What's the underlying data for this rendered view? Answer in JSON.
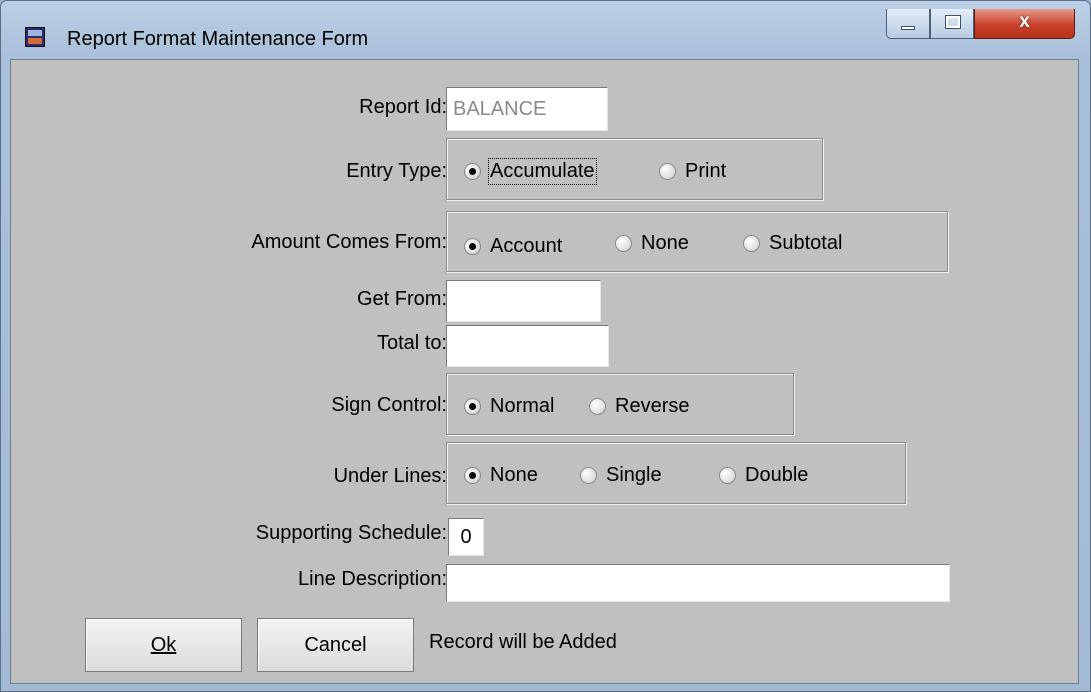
{
  "window": {
    "title": "Report Format Maintenance Form",
    "close_glyph": "x"
  },
  "form": {
    "report_id": {
      "label": "Report Id:",
      "value": "BALANCE"
    },
    "entry_type": {
      "label": "Entry Type:",
      "options": [
        "Accumulate",
        "Print"
      ],
      "selected": "Accumulate"
    },
    "amount_from": {
      "label": "Amount Comes From:",
      "options": [
        "Account",
        "None",
        "Subtotal"
      ],
      "selected": "Account"
    },
    "get_from": {
      "label": "Get From:",
      "value": ""
    },
    "total_to": {
      "label": "Total to:",
      "value": ""
    },
    "sign_control": {
      "label": "Sign Control:",
      "options": [
        "Normal",
        "Reverse"
      ],
      "selected": "Normal"
    },
    "under_lines": {
      "label": "Under Lines:",
      "options": [
        "None",
        "Single",
        "Double"
      ],
      "selected": "None"
    },
    "supporting_schedule": {
      "label": "Supporting Schedule:",
      "value": "0"
    },
    "line_description": {
      "label": "Line Description:",
      "value": ""
    }
  },
  "buttons": {
    "ok": "Ok",
    "cancel": "Cancel"
  },
  "status": "Record will be Added",
  "icons": {
    "app": "report-app-icon",
    "minimize": "minimize-icon",
    "maximize": "maximize-icon",
    "close": "close-icon"
  }
}
